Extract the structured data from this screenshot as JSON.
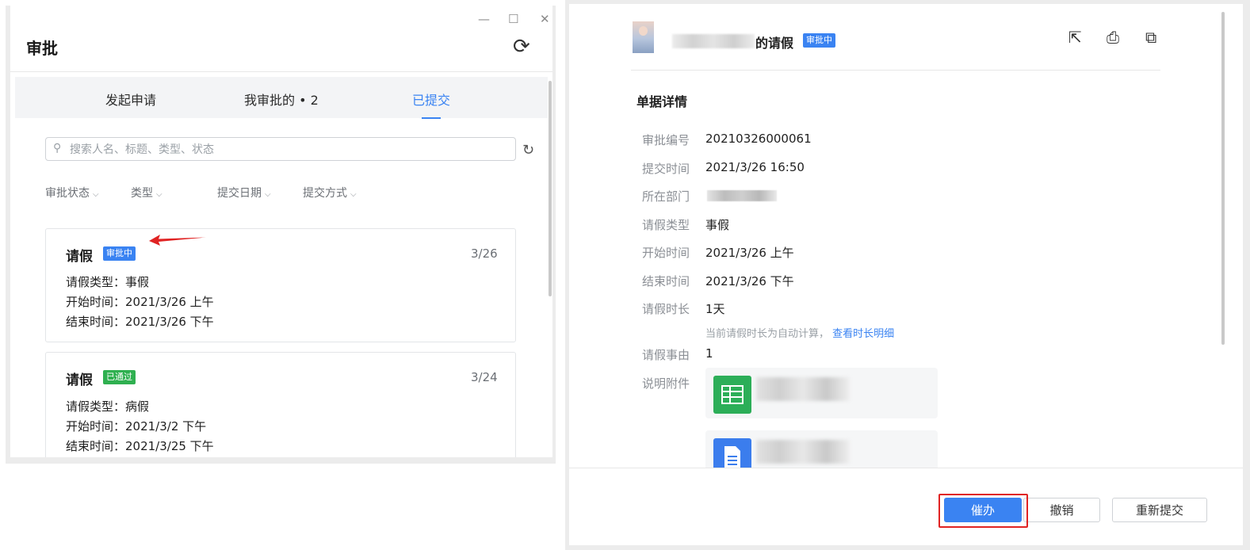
{
  "left": {
    "window_controls": {
      "minimize": "—",
      "maximize": "☐",
      "close": "✕"
    },
    "title": "审批",
    "refresh_icon": "⟳",
    "tabs": [
      {
        "label": "发起申请"
      },
      {
        "label": "我审批的 • 2"
      },
      {
        "label": "已提交"
      }
    ],
    "search": {
      "icon": "⚲",
      "placeholder": "搜索人名、标题、类型、状态",
      "value": ""
    },
    "search_refresh_icon": "↻",
    "filters": [
      {
        "label": "审批状态",
        "chevron": "⌵"
      },
      {
        "label": "类型",
        "chevron": "⌵"
      },
      {
        "label": "提交日期",
        "chevron": "⌵"
      },
      {
        "label": "提交方式",
        "chevron": "⌵"
      }
    ],
    "cards": [
      {
        "title": "请假",
        "status": "审批中",
        "date": "3/26",
        "lines": [
          "请假类型：事假",
          "开始时间：2021/3/26 上午",
          "结束时间：2021/3/26 下午"
        ]
      },
      {
        "title": "请假",
        "status": "已通过",
        "date": "3/24",
        "lines": [
          "请假类型：病假",
          "开始时间：2021/3/2 下午",
          "结束时间：2021/3/25 下午"
        ]
      }
    ]
  },
  "right": {
    "header": {
      "title_suffix": "的请假",
      "status": "审批中",
      "tool_icons": {
        "share": "⇱",
        "print": "⎙",
        "export": "⧉"
      }
    },
    "section_title": "单据详情",
    "fields": [
      {
        "label": "审批编号",
        "value": "20210326000061"
      },
      {
        "label": "提交时间",
        "value": "2021/3/26 16:50"
      },
      {
        "label": "所在部门",
        "value": ""
      },
      {
        "label": "请假类型",
        "value": "事假"
      },
      {
        "label": "开始时间",
        "value": "2021/3/26 上午"
      },
      {
        "label": "结束时间",
        "value": "2021/3/26 下午"
      },
      {
        "label": "请假时长",
        "value": "1天"
      },
      {
        "label": "请假事由",
        "value": "1"
      },
      {
        "label": "说明附件",
        "value": ""
      }
    ],
    "duration_hint": "当前请假时长为自动计算，",
    "duration_link": "查看时长明细",
    "buttons": {
      "urge": "催办",
      "revoke": "撤销",
      "resubmit": "重新提交"
    },
    "colors": {
      "primary": "#3a83f2",
      "success": "#2fb050",
      "annotation": "#e02323"
    }
  }
}
